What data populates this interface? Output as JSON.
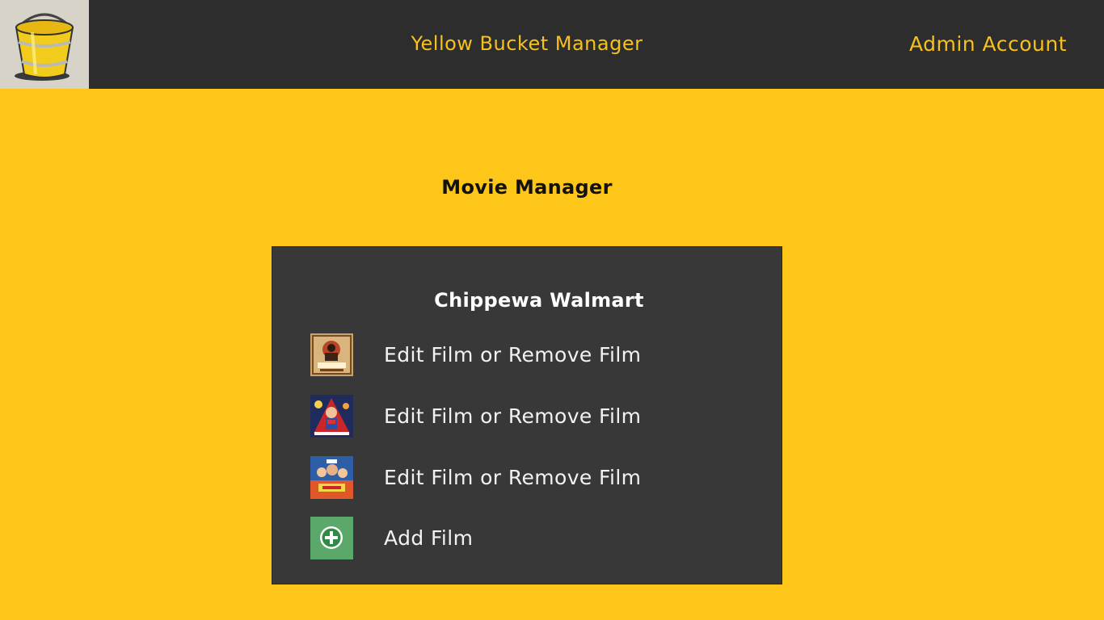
{
  "header": {
    "logo_icon": "yellow-bucket-icon",
    "app_title": "Yellow Bucket Manager",
    "account_label": "Admin Account",
    "background": "#2d2d2d",
    "text_color": "#f6c11d"
  },
  "main": {
    "page_title": "Movie Manager",
    "background": "#fec619"
  },
  "panel": {
    "store_name": "Chippewa Walmart",
    "background": "#383838",
    "films": [
      {
        "poster_icon": "film-poster-1-icon",
        "action_label": "Edit Film or Remove Film"
      },
      {
        "poster_icon": "film-poster-2-icon",
        "action_label": "Edit Film or Remove Film"
      },
      {
        "poster_icon": "film-poster-3-icon",
        "action_label": "Edit Film or Remove Film"
      }
    ],
    "add": {
      "icon": "add-circle-icon",
      "label": "Add Film",
      "accent": "#5aa86a"
    }
  }
}
